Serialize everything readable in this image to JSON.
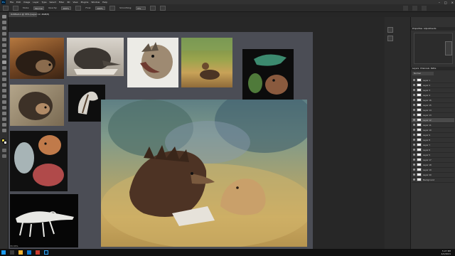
{
  "app": {
    "logo": "Ps",
    "menu": [
      "File",
      "Edit",
      "Image",
      "Layer",
      "Type",
      "Select",
      "Filter",
      "3D",
      "View",
      "Plugins",
      "Window",
      "Help"
    ]
  },
  "options": {
    "mode_label": "Mode:",
    "mode_value": "Normal",
    "opacity_label": "Opacity:",
    "opacity_value": "100%",
    "flow_label": "Flow:",
    "flow_value": "100%",
    "smoothing_label": "Smoothing:",
    "smoothing_value": "0%"
  },
  "document": {
    "tab_title": "Untitled-1 @ 33% (Layer 12, RGB/8)"
  },
  "panels": {
    "top_title": "Properties",
    "top_tab2": "Adjustments",
    "layers_title": "Layers",
    "layers_tab2": "Channels",
    "layers_tab3": "Paths",
    "blend_mode": "Normal",
    "layers": [
      "Layer 1",
      "Layer 2",
      "Layer 3",
      "Layer 4",
      "Layer 16",
      "Layer 15",
      "Layer 14",
      "Layer 13",
      "Layer 12",
      "Layer 11",
      "Layer 10",
      "Layer 9",
      "Layer 8",
      "Layer 7",
      "Layer 6",
      "Layer 5",
      "Layer 17",
      "Layer 18",
      "Layer 19",
      "Layer 20",
      "Background"
    ]
  },
  "status": {
    "zoom": "33.33%"
  },
  "taskbar": {
    "time": "5:27 PM",
    "date": "4/2/2021"
  },
  "colors": {
    "accent": "#31a8ff",
    "board": "#4b4d55"
  }
}
